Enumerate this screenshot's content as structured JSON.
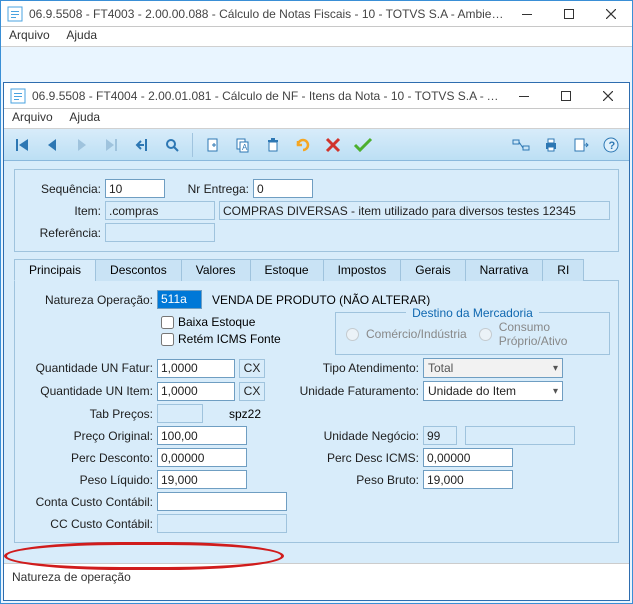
{
  "outer": {
    "title": "06.9.5508 - FT4003 - 2.00.00.088 - Cálculo de Notas Fiscais - 10 - TOTVS S.A - Ambiente ...",
    "menu": {
      "file": "Arquivo",
      "help": "Ajuda"
    }
  },
  "inner": {
    "title": "06.9.5508 - FT4004 - 2.00.01.081 - Cálculo de NF - Itens da Nota - 10 - TOTVS S.A - Amb...",
    "menu": {
      "file": "Arquivo",
      "help": "Ajuda"
    }
  },
  "header": {
    "seq_label": "Sequência:",
    "seq_value": "10",
    "nr_entrega_label": "Nr Entrega:",
    "nr_entrega_value": "0",
    "item_label": "Item:",
    "item_code": ".compras",
    "item_desc": "COMPRAS DIVERSAS - item utilizado para diversos testes 12345",
    "ref_label": "Referência:",
    "ref_value": ""
  },
  "tabs": [
    "Principais",
    "Descontos",
    "Valores",
    "Estoque",
    "Impostos",
    "Gerais",
    "Narrativa",
    "RI"
  ],
  "form": {
    "nat_op_label": "Natureza Operação:",
    "nat_op_code": "511a",
    "nat_op_desc": "VENDA DE PRODUTO (NÃO ALTERAR)",
    "baixa_estoque": "Baixa Estoque",
    "retem_icms": "Retém ICMS Fonte",
    "destino_legend": "Destino da Mercadoria",
    "destino_com": "Comércio/Indústria",
    "destino_cons": "Consumo Próprio/Ativo",
    "qtd_fatur_label": "Quantidade UN Fatur:",
    "qtd_fatur_value": "1,0000",
    "qtd_fatur_un": "CX",
    "tipo_atend_label": "Tipo Atendimento:",
    "tipo_atend_value": "Total",
    "qtd_item_label": "Quantidade UN Item:",
    "qtd_item_value": "1,0000",
    "qtd_item_un": "CX",
    "un_fatur_label": "Unidade Faturamento:",
    "un_fatur_value": "Unidade do Item",
    "tab_precos_label": "Tab Preços:",
    "tab_precos_code": "",
    "tab_precos_desc": "spz22",
    "preco_orig_label": "Preço Original:",
    "preco_orig_value": "100,00",
    "un_neg_label": "Unidade Negócio:",
    "un_neg_value": "99",
    "perc_desc_label": "Perc Desconto:",
    "perc_desc_value": "0,00000",
    "perc_desc_icms_label": "Perc Desc ICMS:",
    "perc_desc_icms_value": "0,00000",
    "peso_liq_label": "Peso Líquido:",
    "peso_liq_value": "19,000",
    "peso_bruto_label": "Peso Bruto:",
    "peso_bruto_value": "19,000",
    "conta_label": "Conta Custo Contábil:",
    "conta_value": "",
    "cc_label": "CC Custo Contábil:",
    "cc_value": ""
  },
  "status": "Natureza de operação"
}
